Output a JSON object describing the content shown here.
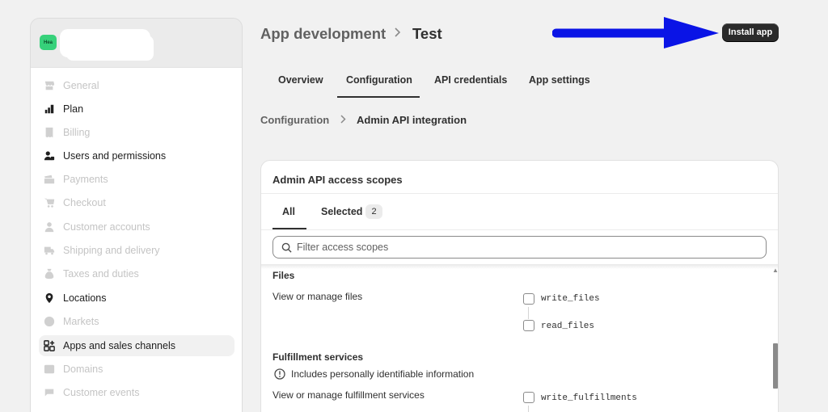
{
  "store": {
    "avatar_text": "Hea"
  },
  "sidebar": {
    "items": [
      {
        "label": "General",
        "icon": "store-icon",
        "state": "dim"
      },
      {
        "label": "Plan",
        "icon": "plan-icon",
        "state": "dark"
      },
      {
        "label": "Billing",
        "icon": "billing-icon",
        "state": "dim"
      },
      {
        "label": "Users and permissions",
        "icon": "users-icon",
        "state": "dark"
      },
      {
        "label": "Payments",
        "icon": "payments-icon",
        "state": "dim"
      },
      {
        "label": "Checkout",
        "icon": "cart-icon",
        "state": "dim"
      },
      {
        "label": "Customer accounts",
        "icon": "person-icon",
        "state": "dim"
      },
      {
        "label": "Shipping and delivery",
        "icon": "truck-icon",
        "state": "dim"
      },
      {
        "label": "Taxes and duties",
        "icon": "money-bag-icon",
        "state": "dim"
      },
      {
        "label": "Locations",
        "icon": "location-pin-icon",
        "state": "dark"
      },
      {
        "label": "Markets",
        "icon": "globe-icon",
        "state": "dim"
      },
      {
        "label": "Apps and sales channels",
        "icon": "apps-icon",
        "state": "active"
      },
      {
        "label": "Domains",
        "icon": "domains-icon",
        "state": "dim"
      },
      {
        "label": "Customer events",
        "icon": "events-icon",
        "state": "dim"
      }
    ]
  },
  "header": {
    "breadcrumb_parent": "App development",
    "breadcrumb_separator": ">",
    "breadcrumb_current": "Test",
    "install_button": "Install app",
    "arrow_color": "#0a14e6"
  },
  "tabs": [
    {
      "label": "Overview"
    },
    {
      "label": "Configuration",
      "active": true
    },
    {
      "label": "API credentials"
    },
    {
      "label": "App settings"
    }
  ],
  "sub_breadcrumb": {
    "parent": "Configuration",
    "separator": ">",
    "current": "Admin API integration"
  },
  "card": {
    "title": "Admin API access scopes",
    "tab_all": "All",
    "tab_selected": "Selected",
    "selected_count": "2",
    "search_placeholder": "Filter access scopes",
    "sections": [
      {
        "title": "Files",
        "description": "View or manage files",
        "scopes": [
          "write_files",
          "read_files"
        ]
      },
      {
        "title": "Fulfillment services",
        "note": "Includes personally identifiable information",
        "description": "View or manage fulfillment services",
        "scopes": [
          "write_fulfillments"
        ]
      }
    ]
  }
}
